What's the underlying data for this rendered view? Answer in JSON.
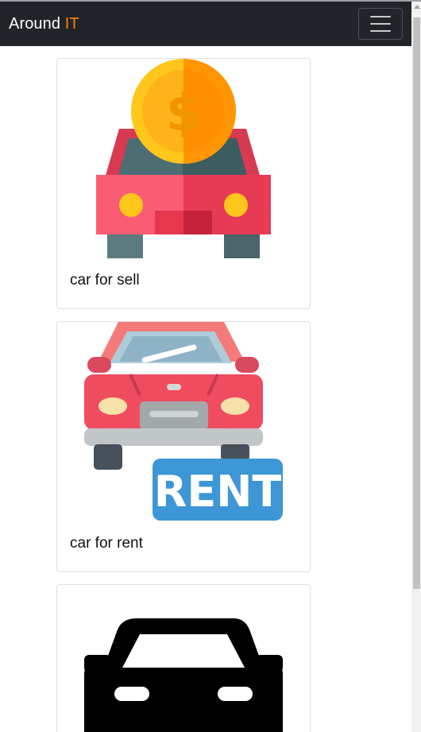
{
  "navbar": {
    "brand_main": "Around",
    "brand_accent": "IT",
    "accent_color": "#fd7e14",
    "background_color": "#212529",
    "toggle_icon": "hamburger-menu-icon"
  },
  "cards": [
    {
      "title": "car for sell",
      "icon": "car-with-coin-icon"
    },
    {
      "title": "car for rent",
      "icon": "car-rent-icon",
      "badge_text": "RENT"
    },
    {
      "title": "",
      "icon": "car-silhouette-icon"
    }
  ]
}
